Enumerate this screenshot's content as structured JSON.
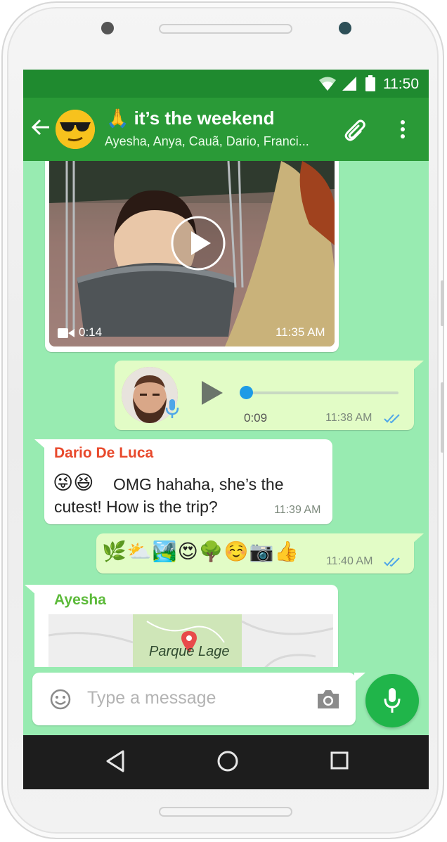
{
  "status_bar": {
    "time": "11:50"
  },
  "header": {
    "title_emoji": "🙏",
    "title": "it’s the weekend",
    "subtitle": "Ayesha, Anya, Cauã, Dario, Franci..."
  },
  "messages": {
    "video": {
      "duration": "0:14",
      "time": "11:35 AM"
    },
    "voice": {
      "duration": "0:09",
      "time": "11:38 AM",
      "progress": 0.0
    },
    "dario": {
      "sender": "Dario De Luca",
      "emojis": "😜😆",
      "text_line1": "OMG hahaha, she’s the",
      "text_line2": "cutest! How is the trip?",
      "time": "11:39 AM"
    },
    "emoji_msg": {
      "emojis": "🌿⛅🏞️😍🌳☺️📷👍",
      "time": "11:40 AM"
    },
    "ayesha": {
      "sender": "Ayesha",
      "map_label": "Parque Lage"
    }
  },
  "input": {
    "placeholder": "Type a message"
  },
  "colors": {
    "status_bar": "#1f8a2f",
    "app_bar": "#2a9a37",
    "chat_bg": "#98ebb1",
    "incoming_bubble": "#ffffff",
    "outgoing_bubble": "#e2fcc6",
    "mic_button": "#20b54a",
    "dario_name": "#e8492c",
    "ayesha_name": "#5cba3a",
    "read_ticks": "#4fa6e8"
  }
}
